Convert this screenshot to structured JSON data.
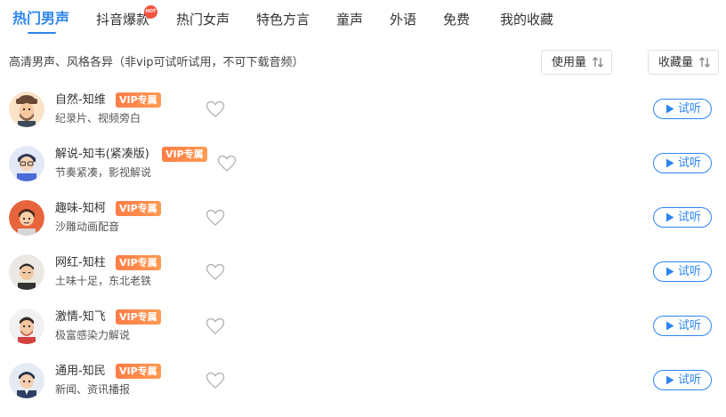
{
  "tabs": [
    {
      "label": "热门男声",
      "active": true
    },
    {
      "label": "抖音爆款",
      "badge": "HOT"
    },
    {
      "label": "热门女声"
    },
    {
      "label": "特色方言"
    },
    {
      "label": "童声"
    },
    {
      "label": "外语"
    },
    {
      "label": "免费"
    },
    {
      "label": "我的收藏"
    }
  ],
  "subtitle": "高清男声、风格各异（非vip可试听试用，不可下载音频）",
  "sort": {
    "usage_label": "使用量",
    "favorites_label": "收藏量",
    "icon": "sort-arrows-icon"
  },
  "voices": [
    {
      "name": "自然-知维",
      "badge": "VIP专属",
      "desc": "纪录片、视频旁白",
      "listen": "试听"
    },
    {
      "name": "解说-知韦(紧凑版)",
      "badge": "VIP专属",
      "desc": "节奏紧凑，影视解说",
      "listen": "试听"
    },
    {
      "name": "趣味-知柯",
      "badge": "VIP专属",
      "desc": "沙雕动画配音",
      "listen": "试听"
    },
    {
      "name": "网红-知柱",
      "badge": "VIP专属",
      "desc": "土味十足，东北老铁",
      "listen": "试听"
    },
    {
      "name": "激情-知飞",
      "badge": "VIP专属",
      "desc": "极富感染力解说",
      "listen": "试听"
    },
    {
      "name": "通用-知民",
      "badge": "VIP专属",
      "desc": "新闻、资讯播报",
      "listen": "试听"
    }
  ],
  "colors": {
    "accent": "#2d86f0",
    "vip": "#ff7d47",
    "hot": "#f5533d"
  }
}
